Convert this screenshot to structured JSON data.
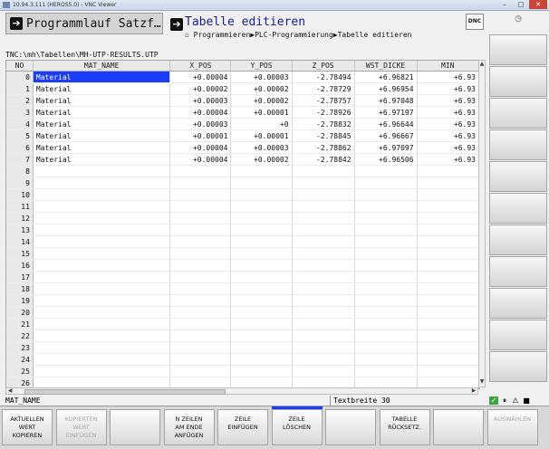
{
  "window": {
    "title": "10.94.3.111 (HEROS5.0) - VNC Viewer"
  },
  "header": {
    "mode_title": "Programmlauf Satzf…",
    "edit_title": "Tabelle editieren",
    "breadcrumb": "Programmieren▶PLC-Programmierung▶Tabelle editieren",
    "dnc_label": "DNC"
  },
  "path": "TNC:\\mh\\Tabellen\\MH-UTP-RESULTS.UTP",
  "table": {
    "columns": [
      "NO",
      "MAT_NAME",
      "X_POS",
      "Y_POS",
      "Z_POS",
      "WST_DICKE",
      "MIN"
    ],
    "rows": [
      [
        "0",
        "Material",
        "+0.00004",
        "+0.00003",
        "-2.78494",
        "+6.96821",
        "+6.93"
      ],
      [
        "1",
        "Material",
        "+0.00002",
        "+0.00002",
        "-2.78729",
        "+6.96954",
        "+6.93"
      ],
      [
        "2",
        "Material",
        "+0.00003",
        "+0.00002",
        "-2.78757",
        "+6.97048",
        "+6.93"
      ],
      [
        "3",
        "Material",
        "+0.00004",
        "+0.00001",
        "-2.78926",
        "+6.97197",
        "+6.93"
      ],
      [
        "4",
        "Material",
        "+0.00003",
        "+0",
        "-2.78832",
        "+6.96644",
        "+6.93"
      ],
      [
        "5",
        "Material",
        "+0.00001",
        "+0.00001",
        "-2.78845",
        "+6.96667",
        "+6.93"
      ],
      [
        "6",
        "Material",
        "+0.00004",
        "+0.00003",
        "-2.78862",
        "+6.97097",
        "+6.93"
      ],
      [
        "7",
        "Material",
        "+0.00004",
        "+0.00002",
        "-2.78842",
        "+6.96506",
        "+6.93"
      ],
      [
        "8",
        "",
        "",
        "",
        "",
        "",
        ""
      ],
      [
        "9",
        "",
        "",
        "",
        "",
        "",
        ""
      ],
      [
        "10",
        "",
        "",
        "",
        "",
        "",
        ""
      ],
      [
        "11",
        "",
        "",
        "",
        "",
        "",
        ""
      ],
      [
        "12",
        "",
        "",
        "",
        "",
        "",
        ""
      ],
      [
        "13",
        "",
        "",
        "",
        "",
        "",
        ""
      ],
      [
        "14",
        "",
        "",
        "",
        "",
        "",
        ""
      ],
      [
        "15",
        "",
        "",
        "",
        "",
        "",
        ""
      ],
      [
        "16",
        "",
        "",
        "",
        "",
        "",
        ""
      ],
      [
        "17",
        "",
        "",
        "",
        "",
        "",
        ""
      ],
      [
        "18",
        "",
        "",
        "",
        "",
        "",
        ""
      ],
      [
        "19",
        "",
        "",
        "",
        "",
        "",
        ""
      ],
      [
        "20",
        "",
        "",
        "",
        "",
        "",
        ""
      ],
      [
        "21",
        "",
        "",
        "",
        "",
        "",
        ""
      ],
      [
        "22",
        "",
        "",
        "",
        "",
        "",
        ""
      ],
      [
        "23",
        "",
        "",
        "",
        "",
        "",
        ""
      ],
      [
        "24",
        "",
        "",
        "",
        "",
        "",
        ""
      ],
      [
        "25",
        "",
        "",
        "",
        "",
        "",
        ""
      ],
      [
        "26",
        "",
        "",
        "",
        "",
        "",
        ""
      ]
    ],
    "selected": {
      "row": 0,
      "col": 1
    }
  },
  "status": {
    "field": "MAT_NAME",
    "width": "Textbreite 30"
  },
  "softkeys": [
    {
      "label": "AKTUELLEN\nWERT\nKOPIEREN",
      "enabled": true
    },
    {
      "label": "KOPIERTEN\nWERT\nEINFÜGEN",
      "enabled": false
    },
    {
      "label": "",
      "enabled": true
    },
    {
      "label": "N ZEILEN\nAM ENDE\nANFÜGEN",
      "enabled": true
    },
    {
      "label": "ZEILE\nEINFÜGEN",
      "enabled": true
    },
    {
      "label": "ZEILE\nLÖSCHEN",
      "enabled": true
    },
    {
      "label": "",
      "enabled": true
    },
    {
      "label": "TABELLE\nRÜCKSETZ.",
      "enabled": true
    },
    {
      "label": "",
      "enabled": true
    },
    {
      "label": "AUSWÄHLEN",
      "enabled": false
    }
  ]
}
